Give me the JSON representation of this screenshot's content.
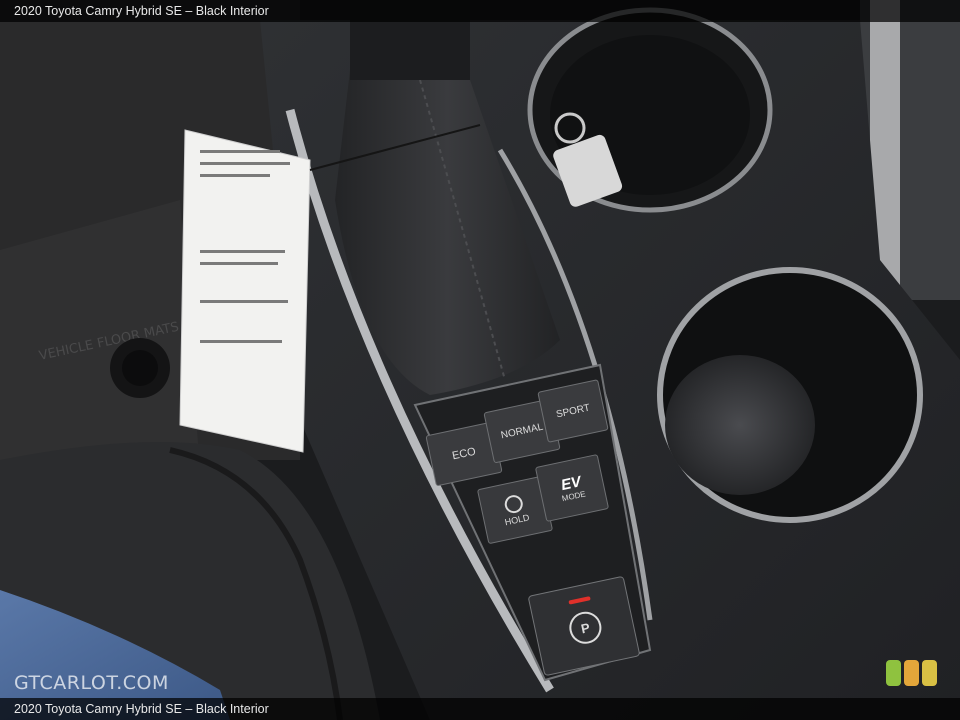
{
  "caption": {
    "top": "2020 Toyota Camry Hybrid SE – Black Interior",
    "bottom": "2020 Toyota Camry Hybrid SE – Black Interior"
  },
  "watermark": "GTCARLOT.COM",
  "brand_dot_colors": [
    "#8fc23f",
    "#e3a63a",
    "#d8c044"
  ],
  "buttons": {
    "eco": "ECO",
    "normal": "NORMAL",
    "sport": "SPORT",
    "hold": "HOLD",
    "ev_top": "EV",
    "ev_bottom": "MODE",
    "parking_brake": "P"
  }
}
